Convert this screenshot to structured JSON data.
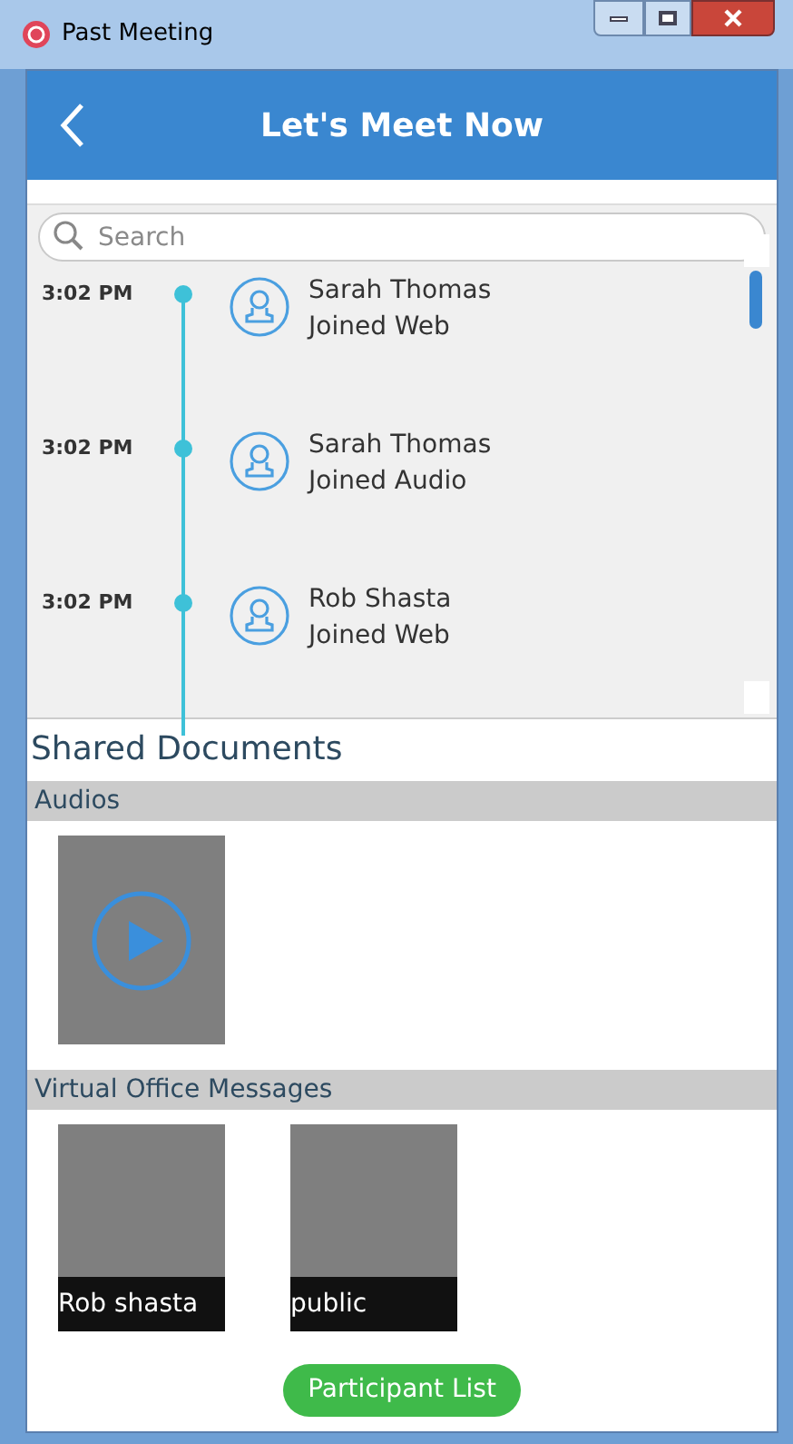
{
  "window": {
    "title": "Past Meeting"
  },
  "header": {
    "title": "Let's Meet Now"
  },
  "search": {
    "placeholder": "Search"
  },
  "timeline": [
    {
      "time": "3:02 PM",
      "name": "Sarah Thomas",
      "action": "Joined Web"
    },
    {
      "time": "3:02 PM",
      "name": "Sarah Thomas",
      "action": "Joined Audio"
    },
    {
      "time": "3:02 PM",
      "name": "Rob Shasta",
      "action": "Joined Web"
    }
  ],
  "shared_documents": {
    "title": "Shared Documents",
    "sections": [
      {
        "title": "Audios",
        "items": [
          {
            "kind": "audio"
          }
        ]
      },
      {
        "title": "Virtual Office Messages",
        "items": [
          {
            "kind": "message",
            "label": "Rob shasta"
          },
          {
            "kind": "message",
            "label": "public"
          }
        ]
      }
    ]
  },
  "button": {
    "label": "Participant List"
  }
}
